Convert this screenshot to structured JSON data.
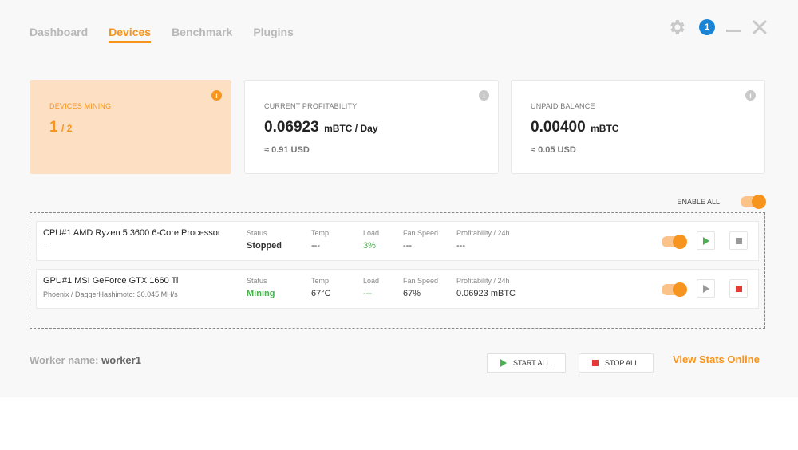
{
  "nav": {
    "tabs": [
      {
        "label": "Dashboard"
      },
      {
        "label": "Devices"
      },
      {
        "label": "Benchmark"
      },
      {
        "label": "Plugins"
      }
    ],
    "active_tab": "Devices"
  },
  "window": {
    "notification_count": "1",
    "icons": [
      "gear-icon",
      "notification-badge",
      "minimize-icon",
      "close-icon"
    ]
  },
  "cards": {
    "devices_mining": {
      "label": "DEVICES MINING",
      "active": "1",
      "total": "/ 2"
    },
    "profitability": {
      "label": "CURRENT PROFITABILITY",
      "value": "0.06923",
      "unit": "mBTC / Day",
      "usd": "≈ 0.91 USD"
    },
    "balance": {
      "label": "UNPAID BALANCE",
      "value": "0.00400",
      "unit": "mBTC",
      "usd": "≈ 0.05 USD"
    },
    "info_glyph": "i"
  },
  "enable_all": {
    "label": "ENABLE ALL",
    "enabled": true
  },
  "columns": {
    "status": "Status",
    "temp": "Temp",
    "load": "Load",
    "fan": "Fan Speed",
    "profit": "Profitability / 24h"
  },
  "devices": [
    {
      "name": "CPU#1 AMD Ryzen 5 3600 6-Core Processor",
      "sub": "---",
      "status": "Stopped",
      "temp": "---",
      "load": "3%",
      "fan": "---",
      "profit": "---",
      "enabled": true
    },
    {
      "name": "GPU#1 MSI GeForce GTX 1660 Ti",
      "sub": "Phoenix / DaggerHashimoto: 30.045 MH/s",
      "status": "Mining",
      "temp": "67°C",
      "load": "---",
      "fan": "67%",
      "profit": "0.06923 mBTC",
      "enabled": true
    }
  ],
  "footer": {
    "worker_label": "Worker name:",
    "worker_name": "worker1",
    "start_all": "START ALL",
    "stop_all": "STOP ALL",
    "view_stats": "View Stats Online"
  },
  "colors": {
    "accent": "#f7941d",
    "mining_green": "#4caf50",
    "stop_red": "#e53935",
    "badge_blue": "#1a85d6"
  }
}
